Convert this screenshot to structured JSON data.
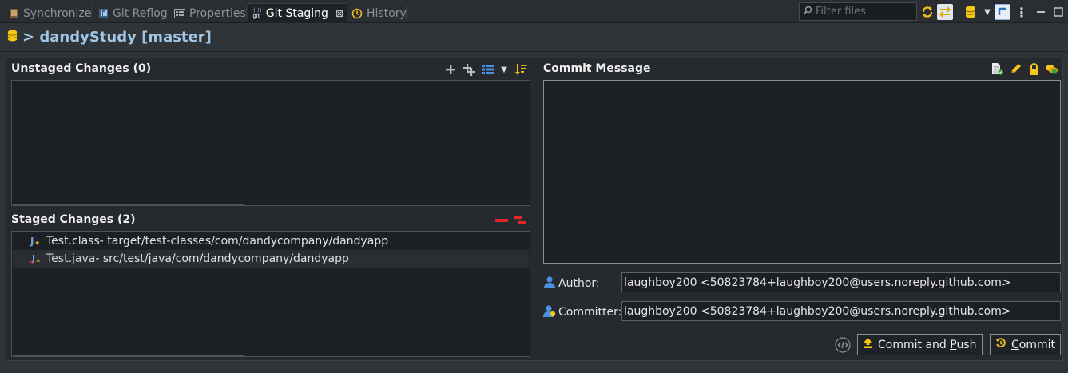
{
  "tabs": [
    {
      "label": "Synchronize",
      "icon": "synchronize-icon",
      "active": false
    },
    {
      "label": "Git Reflog",
      "icon": "git-reflog-icon",
      "active": false
    },
    {
      "label": "Properties",
      "icon": "properties-icon",
      "active": false
    },
    {
      "label": "Git Staging",
      "icon": "git-staging-icon",
      "active": true
    },
    {
      "label": "History",
      "icon": "history-icon",
      "active": false
    }
  ],
  "tab_close": "⊠",
  "filter": {
    "placeholder": "Filter files",
    "value": ""
  },
  "repo": {
    "title": "> dandyStudy [master]"
  },
  "unstaged": {
    "title": "Unstaged Changes (0)",
    "items": []
  },
  "staged": {
    "title": "Staged Changes (2)",
    "items": [
      {
        "name": "Test.class",
        "path": " - target/test-classes/com/dandycompany/dandyapp",
        "status": "added"
      },
      {
        "name": "Test.java",
        "path": " - src/test/java/com/dandycompany/dandyapp",
        "status": "added-with-error"
      }
    ]
  },
  "commit": {
    "title": "Commit Message",
    "message": ""
  },
  "author": {
    "label": "Author:",
    "value": "laughboy200  <50823784+laughboy200@users.noreply.github.com>"
  },
  "committer": {
    "label": "Committer:",
    "value": "laughboy200  <50823784+laughboy200@users.noreply.github.com>"
  },
  "buttons": {
    "commit_and_push_pre": "Commit and ",
    "commit_and_push_mnemonic": "P",
    "commit_and_push_post": "ush",
    "commit_mnemonic": "C",
    "commit_post": "ommit"
  },
  "colors": {
    "background": "#2f3438",
    "panel": "#262a2e",
    "list_bg": "#1c1f23",
    "repo_title": "#9fc6e6",
    "accent_yellow": "#f5c518",
    "accent_blue": "#4a90e2",
    "remove_red": "#e0262b"
  }
}
